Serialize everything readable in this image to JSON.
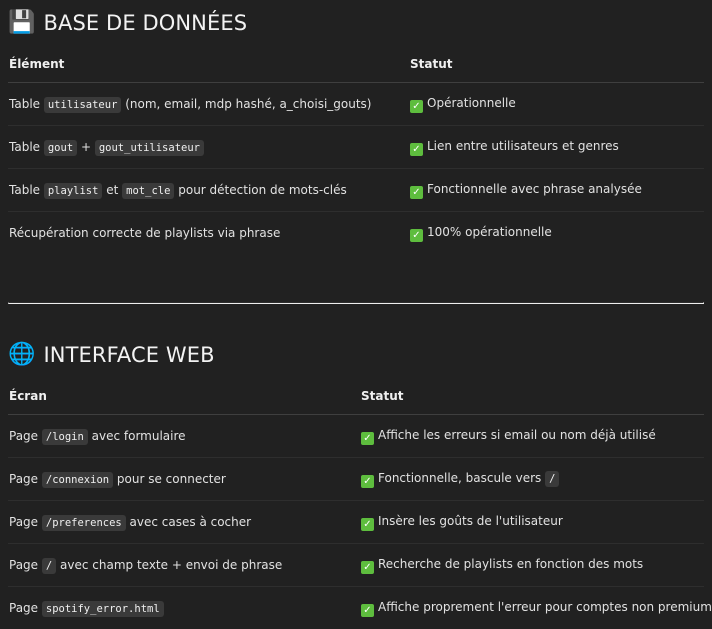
{
  "db": {
    "emoji": "💾",
    "title": "BASE DE DONNÉES",
    "headers": [
      "Élément",
      "Statut"
    ],
    "rows": [
      {
        "prefix": "Table ",
        "code1": "utilisateur",
        "mid": " (nom, email, mdp hashé, a_choisi_gouts)",
        "code2": "",
        "suffix": "",
        "status": "Opérationnelle"
      },
      {
        "prefix": "Table ",
        "code1": "gout",
        "mid": " + ",
        "code2": "gout_utilisateur",
        "suffix": "",
        "status": "Lien entre utilisateurs et genres"
      },
      {
        "prefix": "Table ",
        "code1": "playlist",
        "mid": " et ",
        "code2": "mot_cle",
        "suffix": " pour détection de mots-clés",
        "status": "Fonctionnelle avec phrase analysée"
      },
      {
        "prefix": "Récupération correcte de playlists via phrase",
        "code1": "",
        "mid": "",
        "code2": "",
        "suffix": "",
        "status": "100% opérationnelle"
      }
    ]
  },
  "web": {
    "emoji": "🌐",
    "title": "INTERFACE WEB",
    "headers": [
      "Écran",
      "Statut"
    ],
    "rows": [
      {
        "prefix": "Page ",
        "code1": "/login",
        "suffix": " avec formulaire",
        "status": "Affiche les erreurs si email ou nom déjà utilisé",
        "status_code": ""
      },
      {
        "prefix": "Page ",
        "code1": "/connexion",
        "suffix": " pour se connecter",
        "status": "Fonctionnelle, bascule vers ",
        "status_code": "/"
      },
      {
        "prefix": "Page ",
        "code1": "/preferences",
        "suffix": " avec cases à cocher",
        "status": "Insère les goûts de l'utilisateur",
        "status_code": ""
      },
      {
        "prefix": "Page ",
        "code1": "/",
        "suffix": " avec champ texte + envoi de phrase",
        "status": "Recherche de playlists en fonction des mots",
        "status_code": ""
      },
      {
        "prefix": "Page ",
        "code1": "spotify_error.html",
        "suffix": "",
        "status": "Affiche proprement l'erreur pour comptes non premium",
        "status_code": ""
      }
    ]
  },
  "icons": {
    "check": "check-mark-button-icon",
    "disk": "floppy-disk-icon",
    "globe": "globe-icon"
  },
  "colors": {
    "background": "#212121",
    "check": "#5ebd3e",
    "code_bg": "#3a3a3a"
  }
}
